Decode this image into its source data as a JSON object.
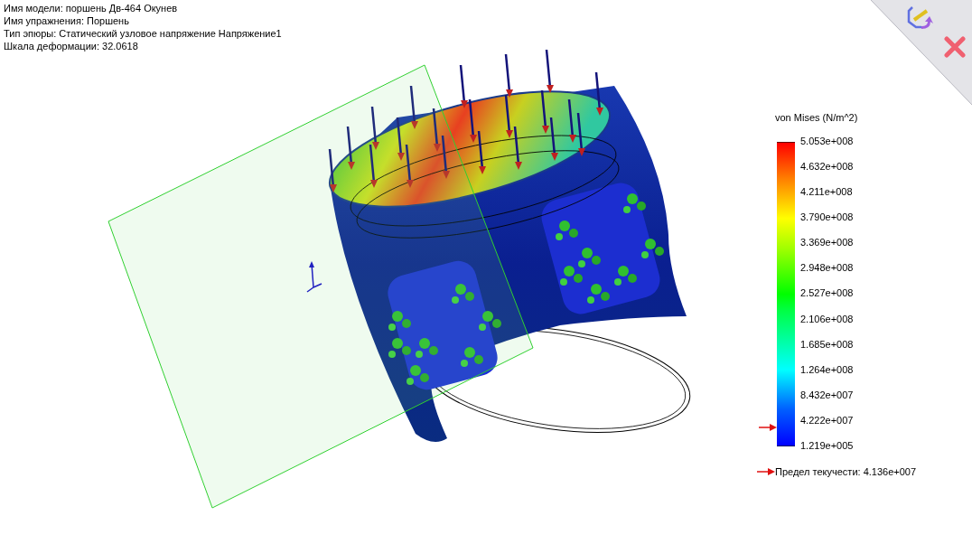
{
  "info_lines": [
    "Имя модели: поршень Дв-464 Окунев",
    "Имя упражнения: Поршень",
    "Тип эпюры: Статический узловое напряжение Напряжение1",
    "Шкала деформации: 32.0618"
  ],
  "legend": {
    "title": "von Mises (N/m^2)",
    "ticks": [
      "5.053e+008",
      "4.632e+008",
      "4.211e+008",
      "3.790e+008",
      "3.369e+008",
      "2.948e+008",
      "2.527e+008",
      "2.106e+008",
      "1.685e+008",
      "1.264e+008",
      "8.432e+007",
      "4.222e+007",
      "1.219e+005"
    ],
    "yield_marker": {
      "level": 0.0816
    },
    "yield_label": "Предел текучести: 4.136e+007"
  }
}
